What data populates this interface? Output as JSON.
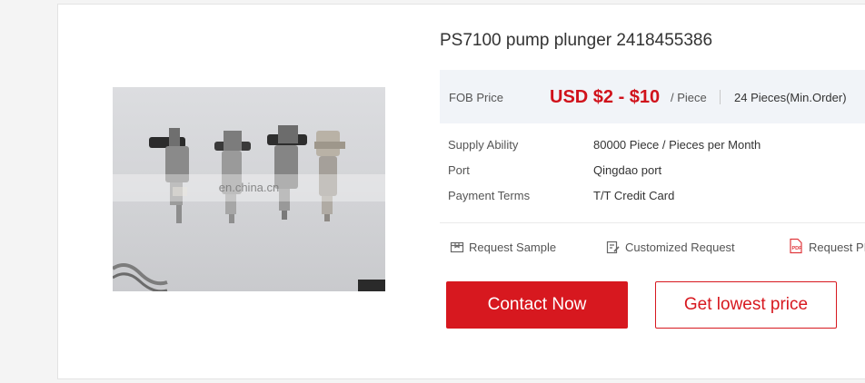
{
  "product": {
    "title": "PS7100 pump plunger 2418455386",
    "image_watermark": "en.china.cn"
  },
  "price": {
    "label": "FOB Price",
    "value": "USD $2 - $10",
    "unit": "/ Piece",
    "min_order": "24 Pieces(Min.Order)"
  },
  "attributes": [
    {
      "label": "Supply Ability",
      "value": "80000 Piece / Pieces per Month"
    },
    {
      "label": "Port",
      "value": "Qingdao port"
    },
    {
      "label": "Payment Terms",
      "value": "T/T Credit Card"
    }
  ],
  "requests": {
    "sample": "Request Sample",
    "customized": "Customized Request",
    "pdf": "Request PDF"
  },
  "buttons": {
    "contact": "Contact Now",
    "lowest_price": "Get lowest price"
  },
  "colors": {
    "accent": "#d7181f",
    "price_band": "#f1f4f8"
  }
}
